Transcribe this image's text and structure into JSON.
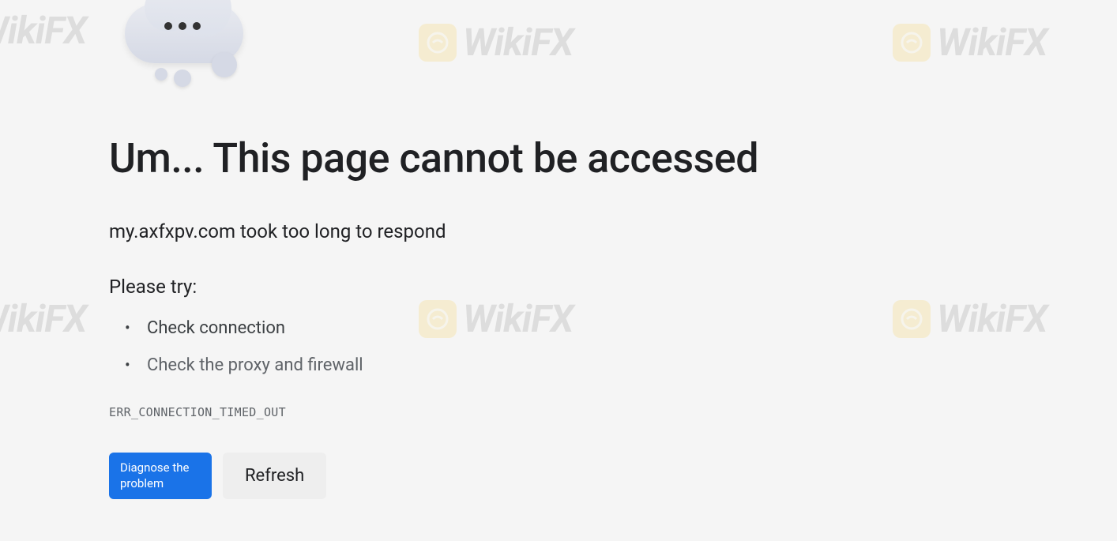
{
  "watermark": {
    "text": "WikiFX"
  },
  "error": {
    "heading": "Um... This page cannot be accessed",
    "subtext": "my.axfxpv.com took too long to respond",
    "try_label": "Please try:",
    "suggestions": [
      "Check connection",
      "Check the proxy and firewall"
    ],
    "error_code": "ERR_CONNECTION_TIMED_OUT"
  },
  "buttons": {
    "diagnose_label": "Diagnose the problem",
    "refresh_label": "Refresh"
  }
}
